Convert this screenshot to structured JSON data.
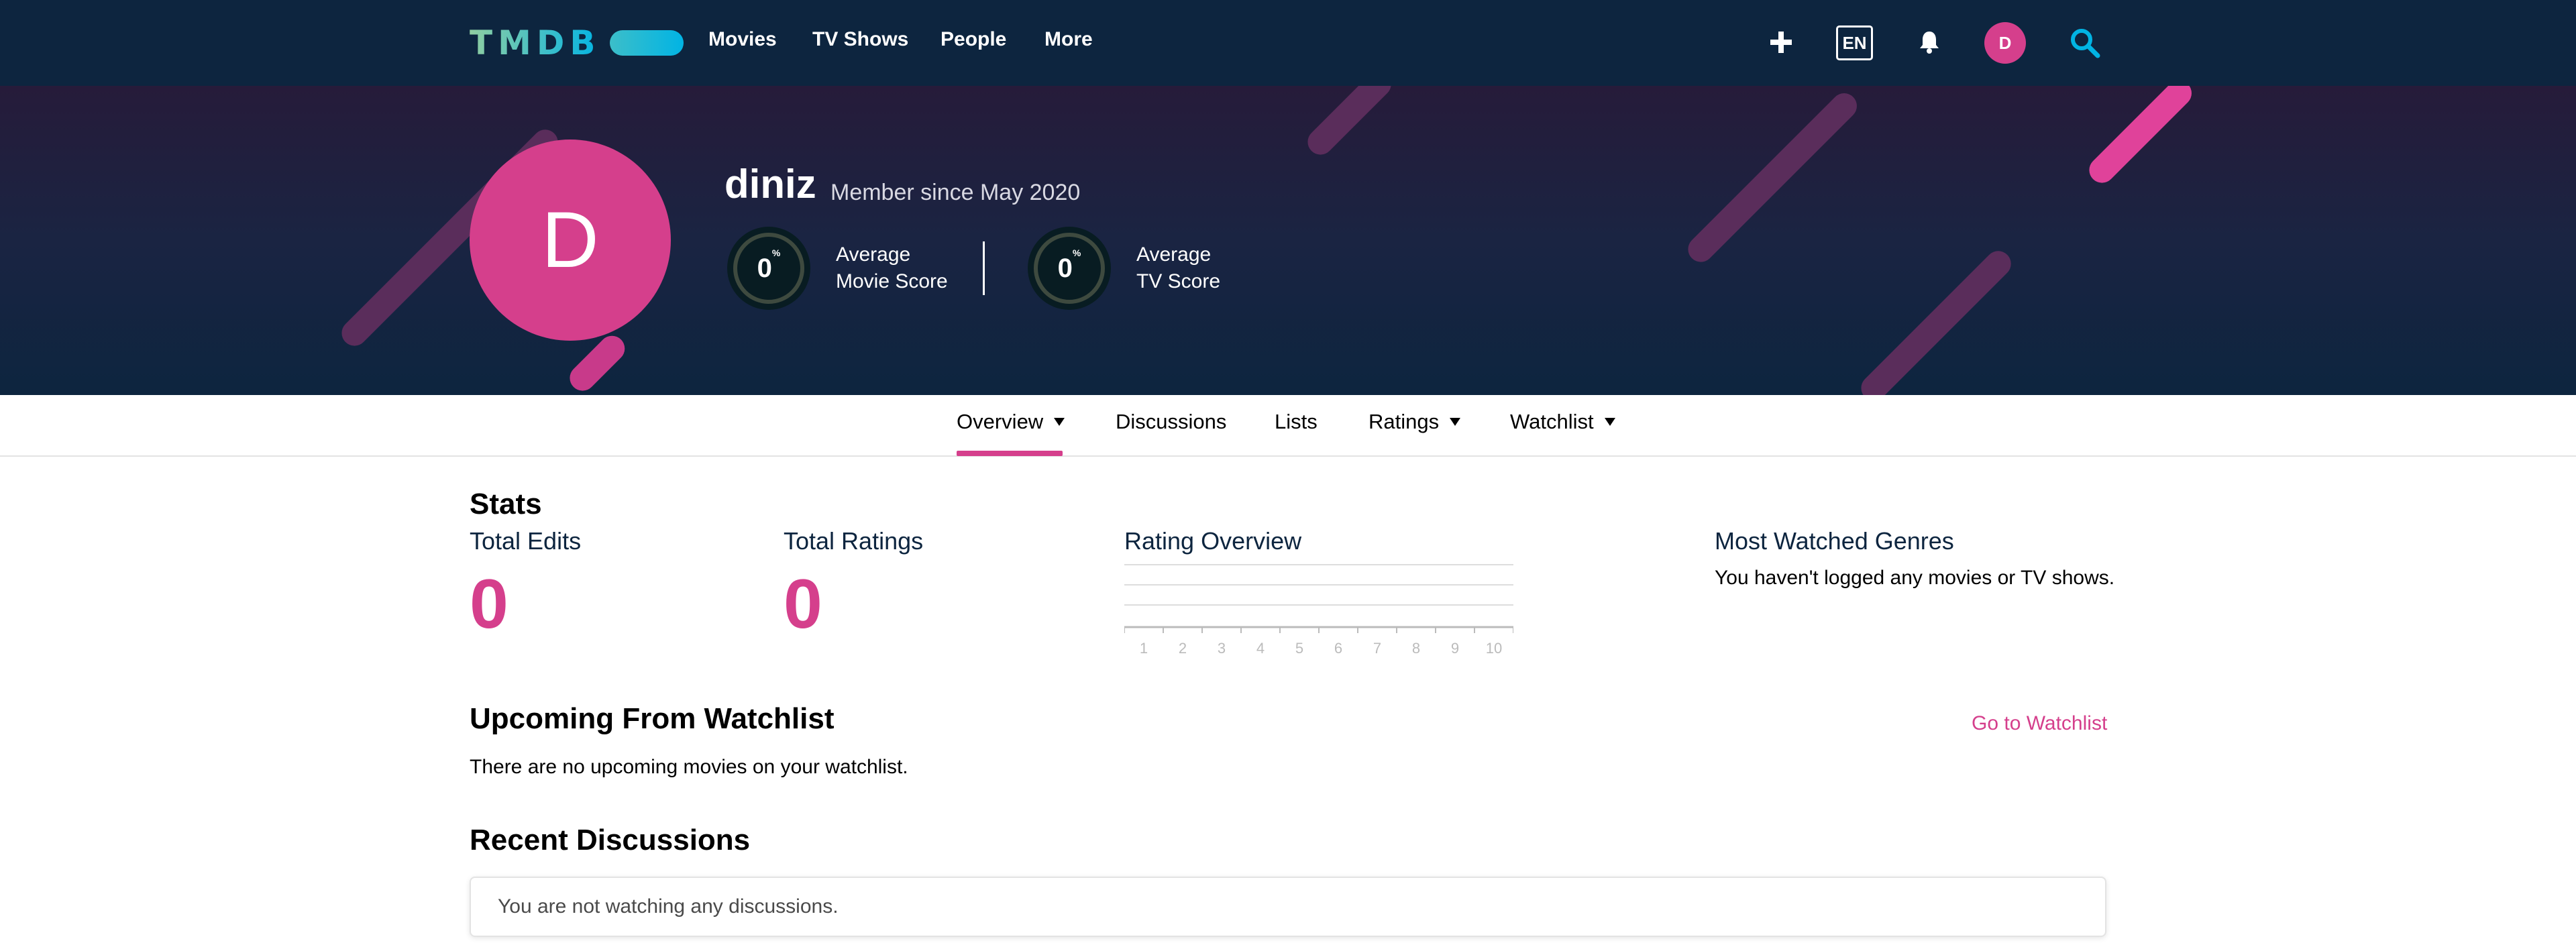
{
  "header": {
    "logo_text": "TMDB",
    "nav": [
      "Movies",
      "TV Shows",
      "People",
      "More"
    ],
    "lang": "EN",
    "avatar_initial": "D",
    "icons": [
      "plus-icon",
      "bell-icon",
      "search-icon"
    ]
  },
  "profile": {
    "avatar_initial": "D",
    "username": "diniz",
    "member_since": "Member since May 2020",
    "movie_score": {
      "value": "0",
      "unit": "%",
      "label_line1": "Average",
      "label_line2": "Movie Score"
    },
    "tv_score": {
      "value": "0",
      "unit": "%",
      "label_line1": "Average",
      "label_line2": "TV Score"
    }
  },
  "subnav": {
    "tabs": [
      {
        "label": "Overview",
        "has_dropdown": true,
        "active": true
      },
      {
        "label": "Discussions",
        "has_dropdown": false,
        "active": false
      },
      {
        "label": "Lists",
        "has_dropdown": false,
        "active": false
      },
      {
        "label": "Ratings",
        "has_dropdown": true,
        "active": false
      },
      {
        "label": "Watchlist",
        "has_dropdown": true,
        "active": false
      }
    ]
  },
  "stats": {
    "title": "Stats",
    "total_edits_label": "Total Edits",
    "total_edits_value": "0",
    "total_ratings_label": "Total Ratings",
    "total_ratings_value": "0",
    "rating_overview_label": "Rating Overview",
    "rating_ticks": [
      "1",
      "2",
      "3",
      "4",
      "5",
      "6",
      "7",
      "8",
      "9",
      "10"
    ],
    "most_watched_label": "Most Watched Genres",
    "most_watched_empty": "You haven't logged any movies or TV shows."
  },
  "upcoming": {
    "title": "Upcoming From Watchlist",
    "link": "Go to Watchlist",
    "empty": "There are no upcoming movies on your watchlist."
  },
  "discussions": {
    "title": "Recent Discussions",
    "empty": "You are not watching any discussions."
  },
  "colors": {
    "navy": "#0d253f",
    "accent_pink": "#d53f8c",
    "score_ring": "#081c22"
  }
}
